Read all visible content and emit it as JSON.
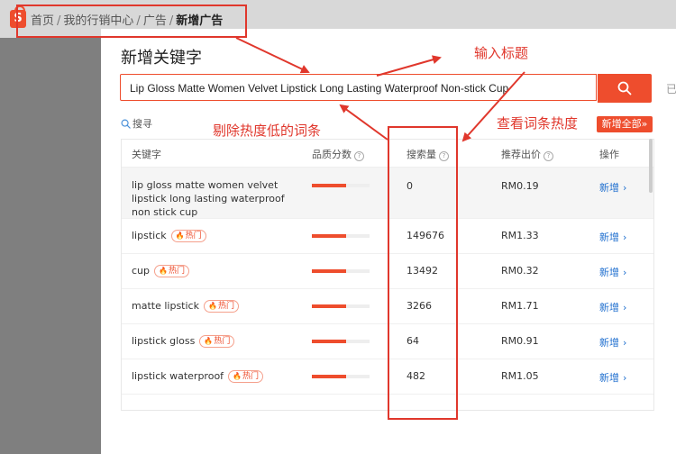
{
  "breadcrumb": {
    "items": [
      "首页",
      "我的行销中心",
      "广告"
    ],
    "current": "新增广告",
    "separator": "/"
  },
  "modal": {
    "title": "新增关键字",
    "keyword_input_value": "Lip Gloss Matte Women Velvet Lipstick Long Lasting Waterproof Non-stick Cup",
    "side_text": "已",
    "filter_label": "搜寻",
    "add_all_label": "新增全部",
    "add_all_chevron": "»"
  },
  "table": {
    "headers": {
      "keyword": "关键字",
      "quality": "品质分数",
      "volume": "搜索量",
      "bid": "推荐出价",
      "action": "操作"
    },
    "help_mark": "?",
    "hot_label": "热门",
    "rows": [
      {
        "keyword": "lip gloss matte women velvet lipstick long lasting waterproof non stick cup",
        "hot": false,
        "quality": 0.6,
        "volume": "0",
        "bid": "RM0.19",
        "action": "新增"
      },
      {
        "keyword": "lipstick",
        "hot": true,
        "quality": 0.6,
        "volume": "149676",
        "bid": "RM1.33",
        "action": "新增"
      },
      {
        "keyword": "cup",
        "hot": true,
        "quality": 0.6,
        "volume": "13492",
        "bid": "RM0.32",
        "action": "新增"
      },
      {
        "keyword": "matte lipstick",
        "hot": true,
        "quality": 0.6,
        "volume": "3266",
        "bid": "RM1.71",
        "action": "新增"
      },
      {
        "keyword": "lipstick gloss",
        "hot": true,
        "quality": 0.6,
        "volume": "64",
        "bid": "RM0.91",
        "action": "新增"
      },
      {
        "keyword": "lipstick waterproof",
        "hot": true,
        "quality": 0.6,
        "volume": "482",
        "bid": "RM1.05",
        "action": "新增"
      }
    ]
  },
  "annotations": {
    "input_title": "输入标题",
    "remove_low": "剔除热度低的词条",
    "check_heat": "查看词条热度"
  },
  "colors": {
    "accent": "#ee4d2d",
    "annotation": "#e0372c",
    "link": "#1f6fcf"
  }
}
